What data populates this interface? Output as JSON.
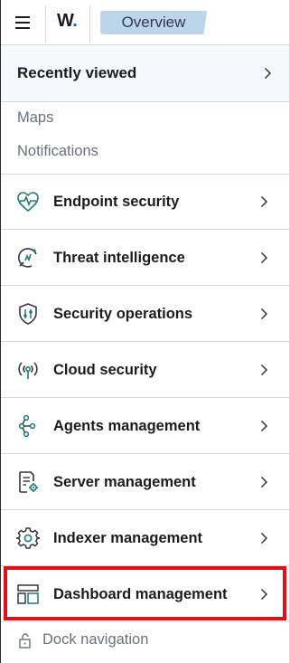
{
  "header": {
    "logo_text": "W",
    "logo_dot": ".",
    "breadcrumb": "Overview"
  },
  "recently_viewed": {
    "title": "Recently viewed",
    "links": [
      "Maps",
      "Notifications"
    ]
  },
  "nav": {
    "items": [
      {
        "label": "Endpoint security",
        "icon": "heartbeat-shield-icon"
      },
      {
        "label": "Threat intelligence",
        "icon": "threat-radar-icon"
      },
      {
        "label": "Security operations",
        "icon": "shield-sliders-icon"
      },
      {
        "label": "Cloud security",
        "icon": "broadcast-icon"
      },
      {
        "label": "Agents management",
        "icon": "agents-nodes-icon"
      },
      {
        "label": "Server management",
        "icon": "document-gear-icon"
      },
      {
        "label": "Indexer management",
        "icon": "gear-icon"
      },
      {
        "label": "Dashboard management",
        "icon": "dashboard-layout-icon"
      }
    ],
    "highlighted_item": "Dashboard management"
  },
  "footer": {
    "dock_label": "Dock navigation",
    "dock_icon": "unlock-icon"
  },
  "colors": {
    "icon_teal": "#1b7a78",
    "highlight_red": "#e0101a",
    "breadcrumb_bg": "#bcd5ea",
    "muted_text": "#6a717d"
  }
}
